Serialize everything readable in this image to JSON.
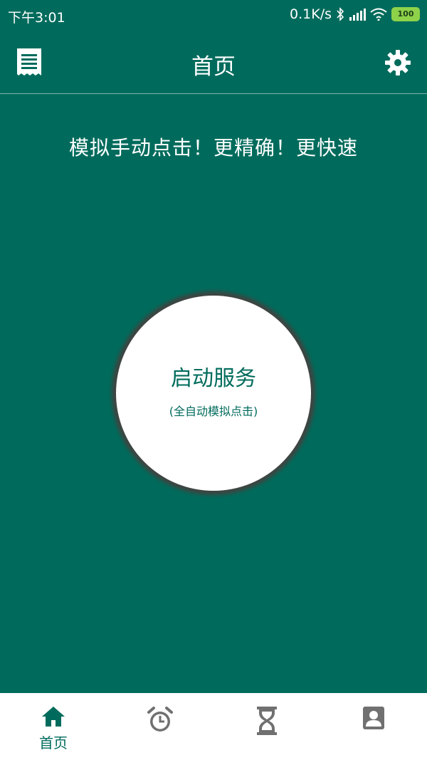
{
  "status_bar": {
    "time": "下午3:01",
    "network_speed": "0.1K/s",
    "battery": "100"
  },
  "app_bar": {
    "title": "首页",
    "left_icon": "receipt-icon",
    "right_icon": "gear-icon"
  },
  "main": {
    "tagline": "模拟手动点击！更精确！更快速",
    "start_button": {
      "label": "启动服务",
      "sublabel": "(全自动模拟点击)"
    }
  },
  "bottom_nav": {
    "items": [
      {
        "label": "首页",
        "icon": "home-icon",
        "active": true
      },
      {
        "label": "",
        "icon": "alarm-clock-icon",
        "active": false
      },
      {
        "label": "",
        "icon": "hourglass-icon",
        "active": false
      },
      {
        "label": "",
        "icon": "contact-icon",
        "active": false
      }
    ]
  },
  "colors": {
    "primary": "#006b5c",
    "inactive_icon": "#707070",
    "battery": "#8ed24a"
  }
}
